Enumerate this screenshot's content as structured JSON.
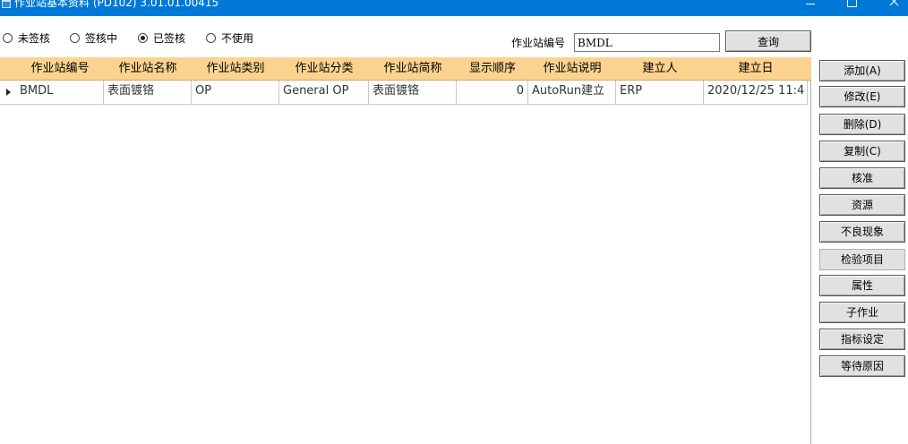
{
  "window": {
    "title": "作业站基本资料 (PD102) 3.01.01.00415",
    "icon": "app-window-icon"
  },
  "filters": {
    "options": [
      {
        "label": "未签核",
        "checked": false
      },
      {
        "label": "签核中",
        "checked": false
      },
      {
        "label": "已签核",
        "checked": true
      },
      {
        "label": "不使用",
        "checked": false
      }
    ]
  },
  "search": {
    "label": "作业站编号",
    "value": "BMDL",
    "button_label": "查询"
  },
  "grid": {
    "header_color": "#fbd38e",
    "columns": [
      "作业站编号",
      "作业站名称",
      "作业站类别",
      "作业站分类",
      "作业站简称",
      "显示顺序",
      "作业站说明",
      "建立人",
      "建立日"
    ],
    "rows": [
      [
        "BMDL",
        "表面镀铬",
        "OP",
        "General OP",
        "表面镀铬",
        "0",
        "AutoRun建立",
        "ERP",
        "2020/12/25 11:4"
      ]
    ]
  },
  "actions": [
    "添加(A)",
    "修改(E)",
    "删除(D)",
    "复制(C)",
    "核准",
    "资源",
    "不良现象",
    "检验项目",
    "属性",
    "子作业",
    "指标设定",
    "等待原因"
  ]
}
